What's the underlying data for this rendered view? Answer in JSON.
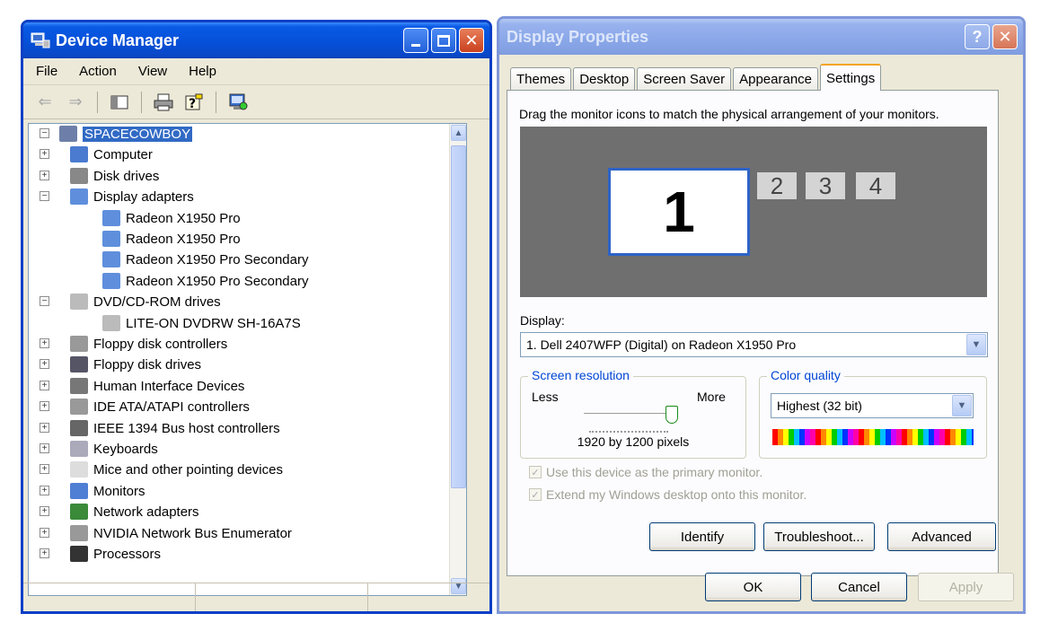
{
  "device_manager": {
    "title": "Device Manager",
    "menu": [
      "File",
      "Action",
      "View",
      "Help"
    ],
    "tree": {
      "root": "SPACECOWBOY",
      "items": [
        {
          "label": "Computer",
          "icon": "computer-icon",
          "expander": "+"
        },
        {
          "label": "Disk drives",
          "icon": "disk-drive-icon",
          "expander": "+"
        },
        {
          "label": "Display adapters",
          "icon": "display-adapter-icon",
          "expander": "-"
        },
        {
          "label": "Radeon X1950 Pro",
          "icon": "display-adapter-icon",
          "child": true
        },
        {
          "label": "Radeon X1950 Pro",
          "icon": "display-adapter-icon",
          "child": true
        },
        {
          "label": "Radeon X1950 Pro Secondary",
          "icon": "display-adapter-icon",
          "child": true
        },
        {
          "label": "Radeon X1950 Pro Secondary",
          "icon": "display-adapter-icon",
          "child": true
        },
        {
          "label": "DVD/CD-ROM drives",
          "icon": "cdrom-icon",
          "expander": "-"
        },
        {
          "label": "LITE-ON DVDRW SH-16A7S",
          "icon": "cdrom-icon",
          "child": true
        },
        {
          "label": "Floppy disk controllers",
          "icon": "controller-icon",
          "expander": "+"
        },
        {
          "label": "Floppy disk drives",
          "icon": "floppy-icon",
          "expander": "+"
        },
        {
          "label": "Human Interface Devices",
          "icon": "hid-icon",
          "expander": "+"
        },
        {
          "label": "IDE ATA/ATAPI controllers",
          "icon": "controller-icon",
          "expander": "+"
        },
        {
          "label": "IEEE 1394 Bus host controllers",
          "icon": "firewire-icon",
          "expander": "+"
        },
        {
          "label": "Keyboards",
          "icon": "keyboard-icon",
          "expander": "+"
        },
        {
          "label": "Mice and other pointing devices",
          "icon": "mouse-icon",
          "expander": "+"
        },
        {
          "label": "Monitors",
          "icon": "monitor-icon",
          "expander": "+"
        },
        {
          "label": "Network adapters",
          "icon": "network-icon",
          "expander": "+"
        },
        {
          "label": "NVIDIA Network Bus Enumerator",
          "icon": "enumerator-icon",
          "expander": "+"
        },
        {
          "label": "Processors",
          "icon": "processor-icon",
          "expander": "+"
        }
      ]
    }
  },
  "display_properties": {
    "title": "Display Properties",
    "tabs": [
      "Themes",
      "Desktop",
      "Screen Saver",
      "Appearance",
      "Settings"
    ],
    "active_tab": "Settings",
    "instruction": "Drag the monitor icons to match the physical arrangement of your monitors.",
    "monitors": [
      "1",
      "2",
      "3",
      "4"
    ],
    "display_label": "Display:",
    "display_value": "1. Dell 2407WFP (Digital) on Radeon X1950 Pro",
    "resolution": {
      "title": "Screen resolution",
      "less": "Less",
      "more": "More",
      "value": "1920 by 1200 pixels",
      "slider_level": 1.0
    },
    "color_quality": {
      "title": "Color quality",
      "value": "Highest (32 bit)"
    },
    "checkboxes": [
      {
        "label": "Use this device as the primary monitor.",
        "checked": true,
        "disabled": true
      },
      {
        "label": "Extend my Windows desktop onto this monitor.",
        "checked": true,
        "disabled": true
      }
    ],
    "buttons": {
      "identify": "Identify",
      "troubleshoot": "Troubleshoot...",
      "advanced": "Advanced",
      "ok": "OK",
      "cancel": "Cancel",
      "apply": "Apply"
    }
  }
}
